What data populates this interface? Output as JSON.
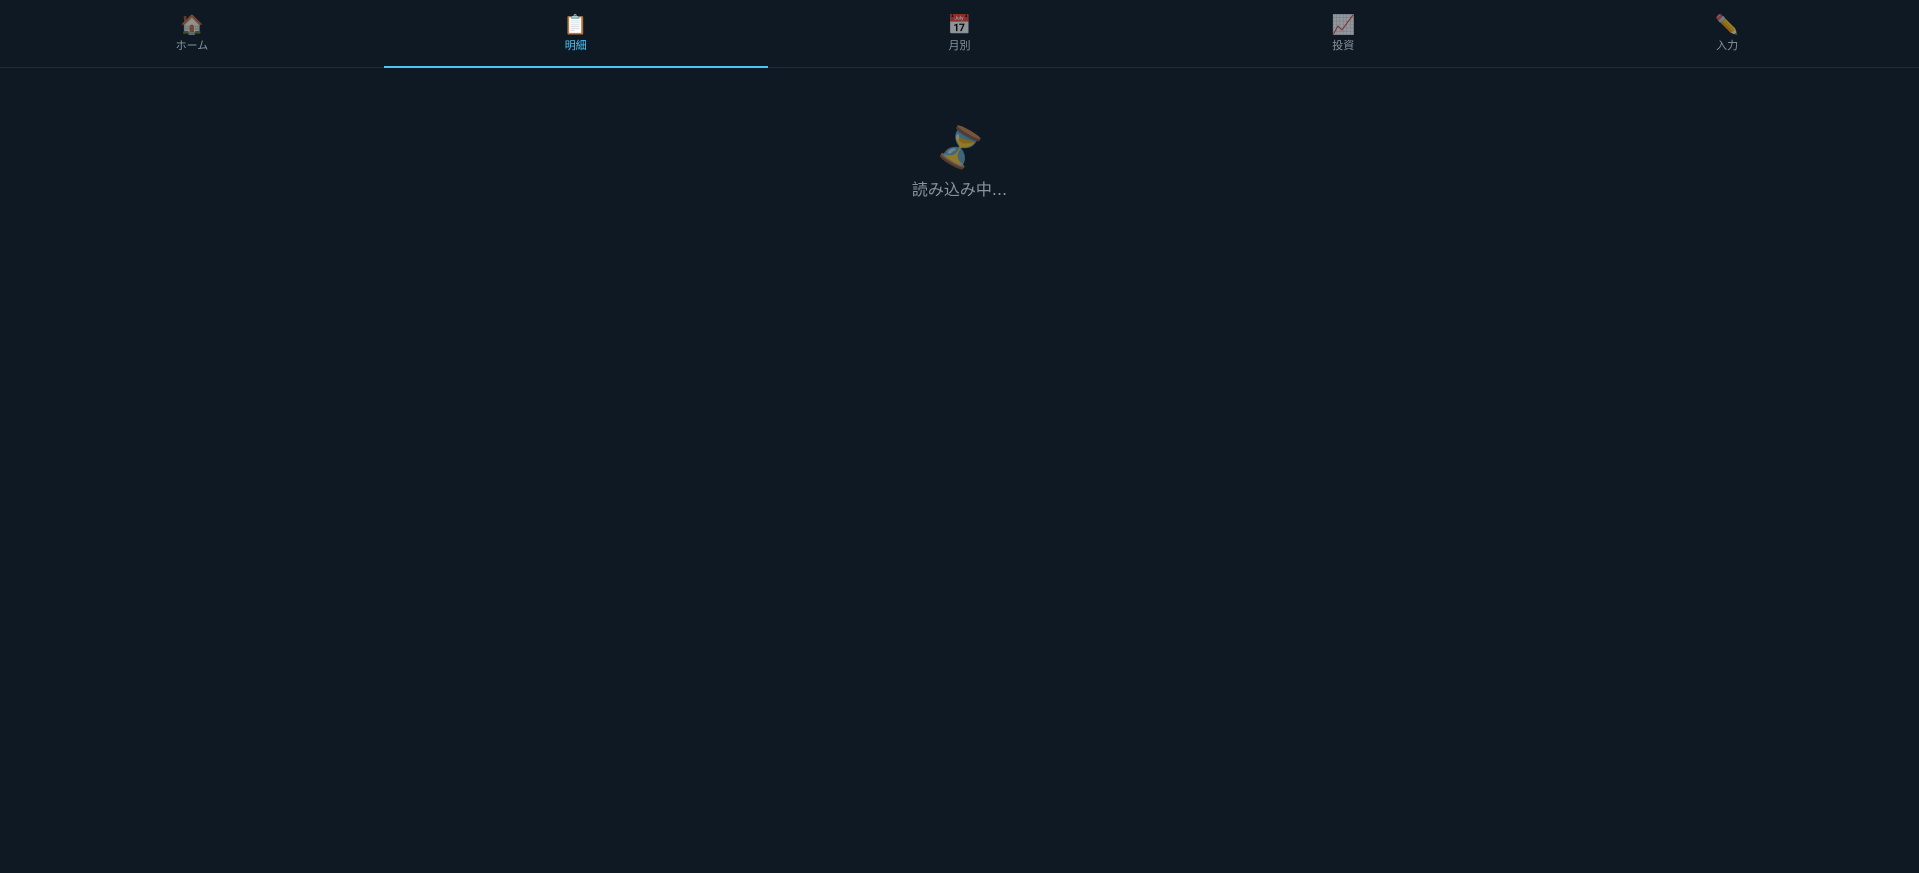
{
  "tabs": [
    {
      "label": "ホーム",
      "icon": "🏠",
      "icon_name": "home-icon",
      "active": false
    },
    {
      "label": "明細",
      "icon": "📋",
      "icon_name": "clipboard-icon",
      "active": true
    },
    {
      "label": "月別",
      "icon": "📅",
      "icon_name": "calendar-icon",
      "active": false
    },
    {
      "label": "投資",
      "icon": "📈",
      "icon_name": "chart-increasing-icon",
      "active": false
    },
    {
      "label": "入力",
      "icon": "✏️",
      "icon_name": "pencil-icon",
      "active": false
    }
  ],
  "loading": {
    "icon": "⏳",
    "icon_name": "hourglass-icon",
    "text": "読み込み中..."
  },
  "colors": {
    "background": "#0f1923",
    "accent": "#4fc3f7",
    "muted_text": "#8a949d"
  }
}
